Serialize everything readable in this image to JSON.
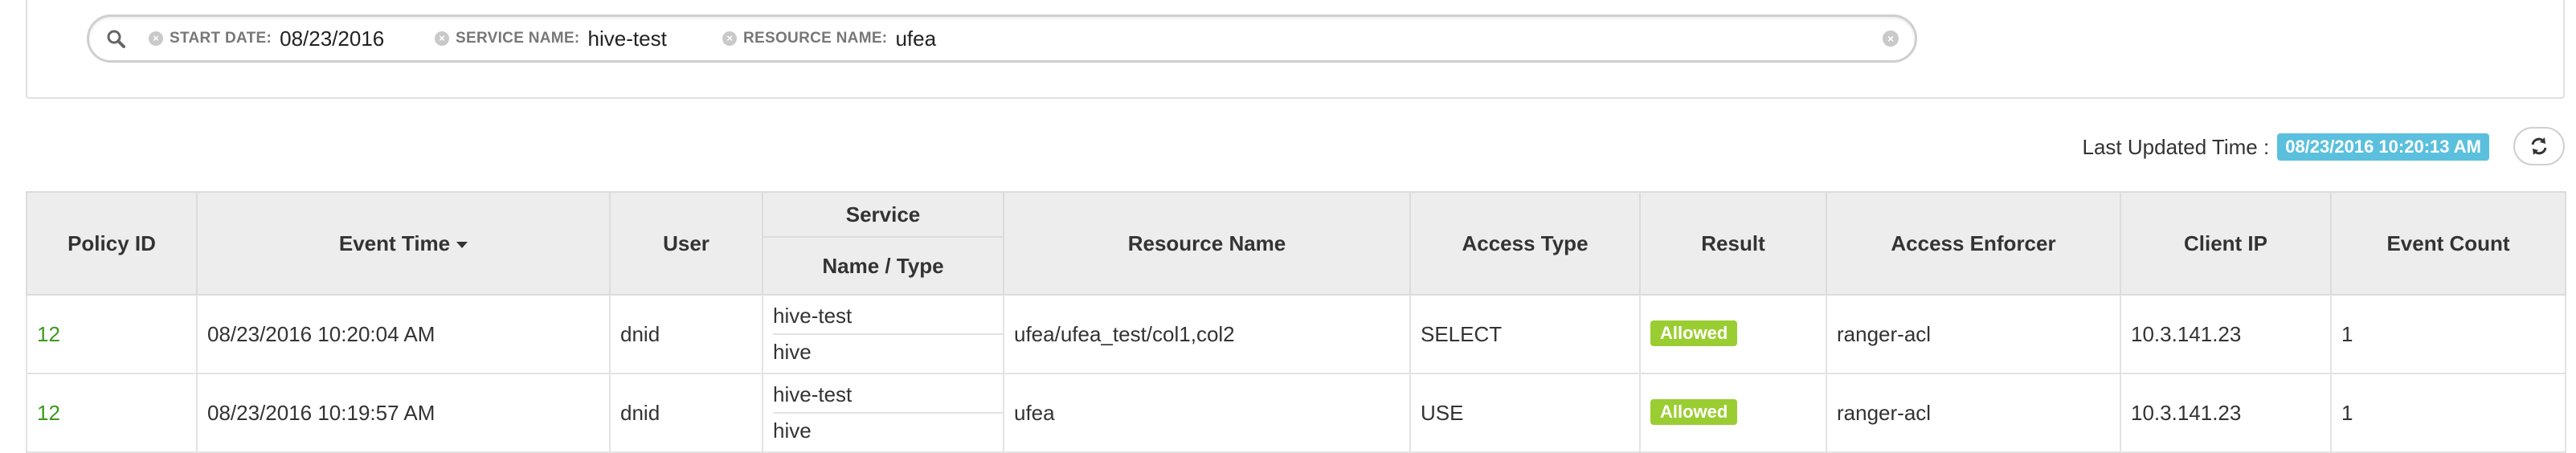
{
  "search": {
    "facets": [
      {
        "category": "START DATE:",
        "value": "08/23/2016"
      },
      {
        "category": "SERVICE NAME:",
        "value": "hive-test"
      },
      {
        "category": "RESOURCE NAME:",
        "value": "ufea"
      }
    ]
  },
  "status": {
    "last_updated_label": "Last Updated Time :",
    "last_updated_value": "08/23/2016 10:20:13 AM"
  },
  "table": {
    "headers": {
      "policy_id": "Policy ID",
      "event_time": "Event Time",
      "user": "User",
      "service": "Service",
      "service_sub": "Name / Type",
      "resource_name": "Resource Name",
      "access_type": "Access Type",
      "result": "Result",
      "access_enforcer": "Access Enforcer",
      "client_ip": "Client IP",
      "event_count": "Event Count"
    },
    "rows": [
      {
        "policy_id": "12",
        "event_time": "08/23/2016 10:20:04 AM",
        "user": "dnid",
        "service_name": "hive-test",
        "service_type": "hive",
        "resource_name": "ufea/ufea_test/col1,col2",
        "access_type": "SELECT",
        "result": "Allowed",
        "access_enforcer": "ranger-acl",
        "client_ip": "10.3.141.23",
        "event_count": "1"
      },
      {
        "policy_id": "12",
        "event_time": "08/23/2016 10:19:57 AM",
        "user": "dnid",
        "service_name": "hive-test",
        "service_type": "hive",
        "resource_name": "ufea",
        "access_type": "USE",
        "result": "Allowed",
        "access_enforcer": "ranger-acl",
        "client_ip": "10.3.141.23",
        "event_count": "1"
      }
    ]
  },
  "colors": {
    "badge_info": "#5bc0de",
    "badge_success": "#9acd32",
    "link_green": "#3a9a1a",
    "header_bg": "#ededed"
  },
  "icons": {
    "search": "search-icon",
    "facet_remove": "close-circle-icon",
    "clear": "close-circle-icon",
    "refresh": "refresh-icon",
    "sort": "caret-down-icon"
  }
}
